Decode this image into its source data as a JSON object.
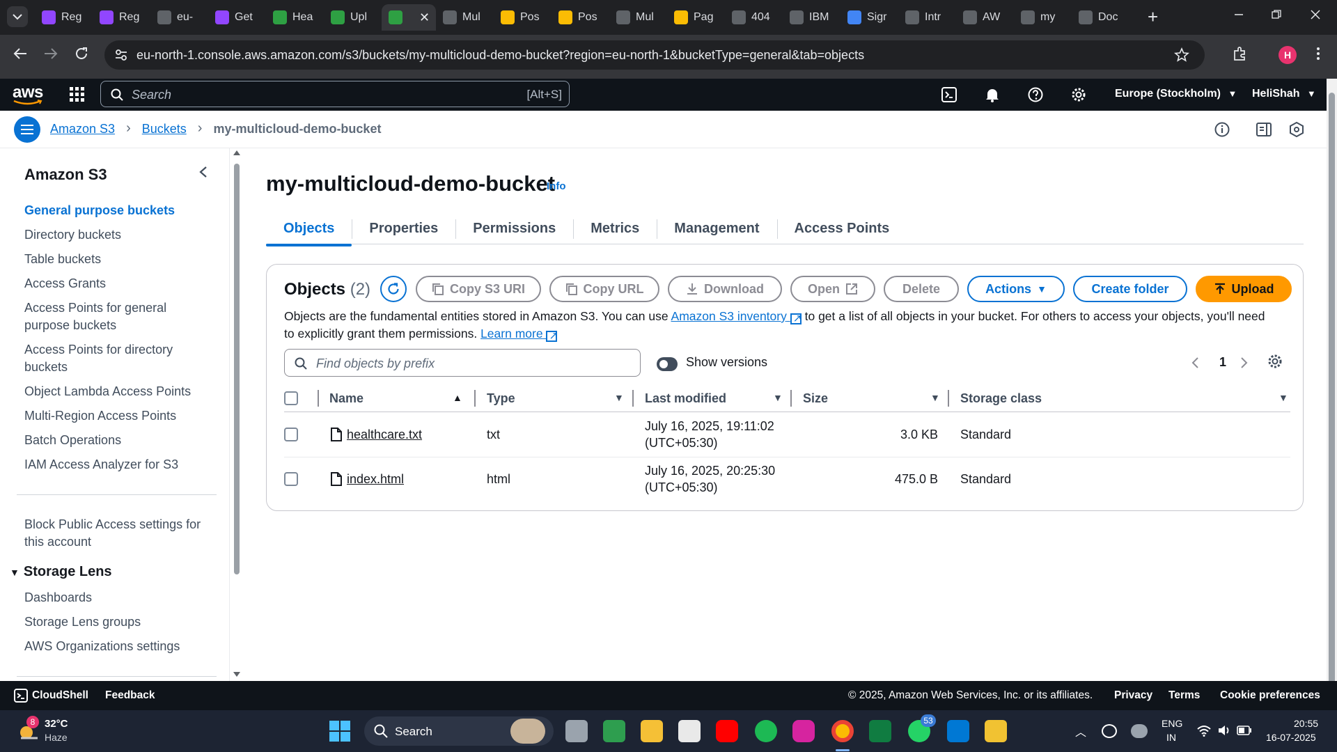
{
  "browser": {
    "tabs": [
      {
        "label": "Reg",
        "icon": "aws-cube-icon",
        "color": "#9146ff"
      },
      {
        "label": "Reg",
        "icon": "aws-cube-icon",
        "color": "#9146ff"
      },
      {
        "label": "eu-",
        "icon": "page-icon",
        "color": "#5f6368"
      },
      {
        "label": "Get",
        "icon": "aws-cube-icon",
        "color": "#9146ff"
      },
      {
        "label": "Hea",
        "icon": "green-box-icon",
        "color": "#2ea043"
      },
      {
        "label": "Upl",
        "icon": "green-box-icon",
        "color": "#2ea043"
      },
      {
        "label": "",
        "icon": "green-box-icon",
        "color": "#2ea043",
        "active": true
      },
      {
        "label": "Mul",
        "icon": "globe-icon",
        "color": "#5f6368"
      },
      {
        "label": "Pos",
        "icon": "drive-icon",
        "color": "#fbbc04"
      },
      {
        "label": "Pos",
        "icon": "drive-icon",
        "color": "#fbbc04"
      },
      {
        "label": "Mul",
        "icon": "globe-icon",
        "color": "#5f6368"
      },
      {
        "label": "Pag",
        "icon": "drive-icon",
        "color": "#fbbc04"
      },
      {
        "label": "404",
        "icon": "globe-icon",
        "color": "#5f6368"
      },
      {
        "label": "IBM",
        "icon": "ibm-icon",
        "color": "#5f6368"
      },
      {
        "label": "Sigr",
        "icon": "cloud-icon",
        "color": "#4285f4"
      },
      {
        "label": "Intr",
        "icon": "ai-icon",
        "color": "#5f6368"
      },
      {
        "label": "AW",
        "icon": "chatgpt-icon",
        "color": "#5f6368"
      },
      {
        "label": "my",
        "icon": "globe-icon",
        "color": "#5f6368"
      },
      {
        "label": "Doc",
        "icon": "globe-icon",
        "color": "#5f6368"
      }
    ],
    "active_close": "✕",
    "new_tab": "+",
    "url": "eu-north-1.console.aws.amazon.com/s3/buckets/my-multicloud-demo-bucket?region=eu-north-1&bucketType=general&tab=objects",
    "profile_initial": "H"
  },
  "aws_nav": {
    "logo": "aws",
    "search_placeholder": "Search",
    "search_shortcut": "[Alt+S]",
    "region": "Europe (Stockholm)",
    "user": "HeliShah"
  },
  "breadcrumb": {
    "items": [
      "Amazon S3",
      "Buckets"
    ],
    "current": "my-multicloud-demo-bucket"
  },
  "sidebar": {
    "title": "Amazon S3",
    "items": [
      "General purpose buckets",
      "Directory buckets",
      "Table buckets",
      "Access Grants",
      "Access Points for general purpose buckets",
      "Access Points for directory buckets",
      "Object Lambda Access Points",
      "Multi-Region Access Points",
      "Batch Operations",
      "IAM Access Analyzer for S3"
    ],
    "block_public": "Block Public Access settings for this account",
    "storage_lens": {
      "title": "Storage Lens",
      "items": [
        "Dashboards",
        "Storage Lens groups",
        "AWS Organizations settings"
      ]
    }
  },
  "bucket": {
    "name": "my-multicloud-demo-bucket",
    "info": "Info",
    "tabs": [
      "Objects",
      "Properties",
      "Permissions",
      "Metrics",
      "Management",
      "Access Points"
    ]
  },
  "objects": {
    "title": "Objects",
    "count": "(2)",
    "buttons": {
      "copy_uri": "Copy S3 URI",
      "copy_url": "Copy URL",
      "download": "Download",
      "open": "Open",
      "delete": "Delete",
      "actions": "Actions",
      "create_folder": "Create folder",
      "upload": "Upload"
    },
    "desc_pre": "Objects are the fundamental entities stored in Amazon S3. You can use",
    "desc_link": "Amazon S3 inventory",
    "desc_post": "to get a list of all objects in your bucket. For others to access your objects, you'll need to explicitly grant them permissions.",
    "learn_more": "Learn more",
    "search_placeholder": "Find objects by prefix",
    "show_versions": "Show versions",
    "page": "1",
    "columns": [
      "Name",
      "Type",
      "Last modified",
      "Size",
      "Storage class"
    ],
    "rows": [
      {
        "name": "healthcare.txt",
        "type": "txt",
        "modified": "July 16, 2025, 19:11:02",
        "tz": "(UTC+05:30)",
        "size": "3.0 KB",
        "class": "Standard"
      },
      {
        "name": "index.html",
        "type": "html",
        "modified": "July 16, 2025, 20:25:30",
        "tz": "(UTC+05:30)",
        "size": "475.0 B",
        "class": "Standard"
      }
    ]
  },
  "footer": {
    "cloudshell": "CloudShell",
    "feedback": "Feedback",
    "copyright": "© 2025, Amazon Web Services, Inc. or its affiliates.",
    "privacy": "Privacy",
    "terms": "Terms",
    "cookies": "Cookie preferences"
  },
  "taskbar": {
    "weather_temp": "32°C",
    "weather_desc": "Haze",
    "weather_badge": "8",
    "search": "Search",
    "whatsapp_badge": "53",
    "lang1": "ENG",
    "lang2": "IN",
    "time": "20:55",
    "date": "16-07-2025"
  }
}
